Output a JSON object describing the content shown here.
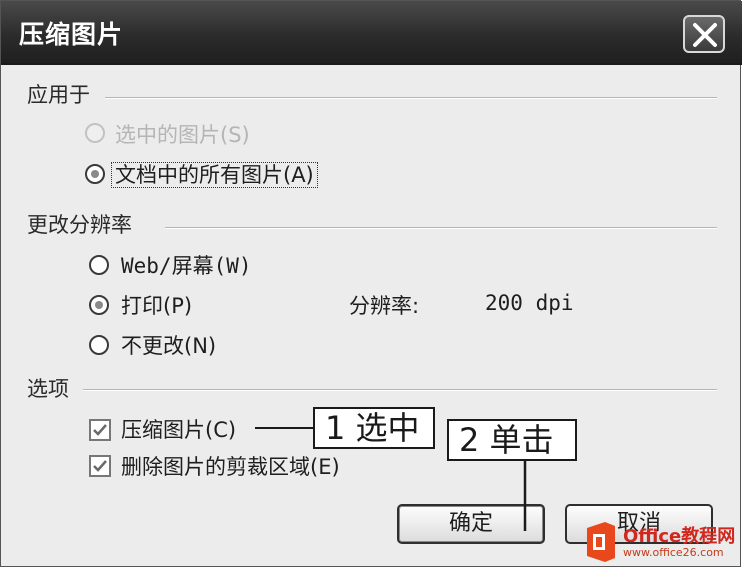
{
  "window": {
    "title": "压缩图片",
    "close_icon": "close-icon"
  },
  "apply_to": {
    "heading": "应用于",
    "options": [
      {
        "label": "选中的图片(S)",
        "selected": false,
        "disabled": true
      },
      {
        "label": "文档中的所有图片(A)",
        "selected": true,
        "disabled": false
      }
    ]
  },
  "resolution": {
    "heading": "更改分辨率",
    "options": [
      {
        "label": "Web/屏幕(W)",
        "selected": false
      },
      {
        "label": "打印(P)",
        "selected": true
      },
      {
        "label": "不更改(N)",
        "selected": false
      }
    ],
    "resolution_label": "分辨率:",
    "resolution_value": "200 dpi"
  },
  "options_group": {
    "heading": "选项",
    "checkboxes": [
      {
        "label": "压缩图片(C)",
        "checked": true
      },
      {
        "label": "删除图片的剪裁区域(E)",
        "checked": true
      }
    ]
  },
  "buttons": {
    "ok": "确定",
    "cancel": "取消"
  },
  "callouts": {
    "step1": "1 选中",
    "step2": "2 单击"
  },
  "watermark": {
    "brand": "Office教程网",
    "url": "www.office26.com"
  },
  "colors": {
    "titlebar": "#2c2c2c",
    "dialog_bg": "#ececec",
    "logo_red": "#d0281f"
  }
}
